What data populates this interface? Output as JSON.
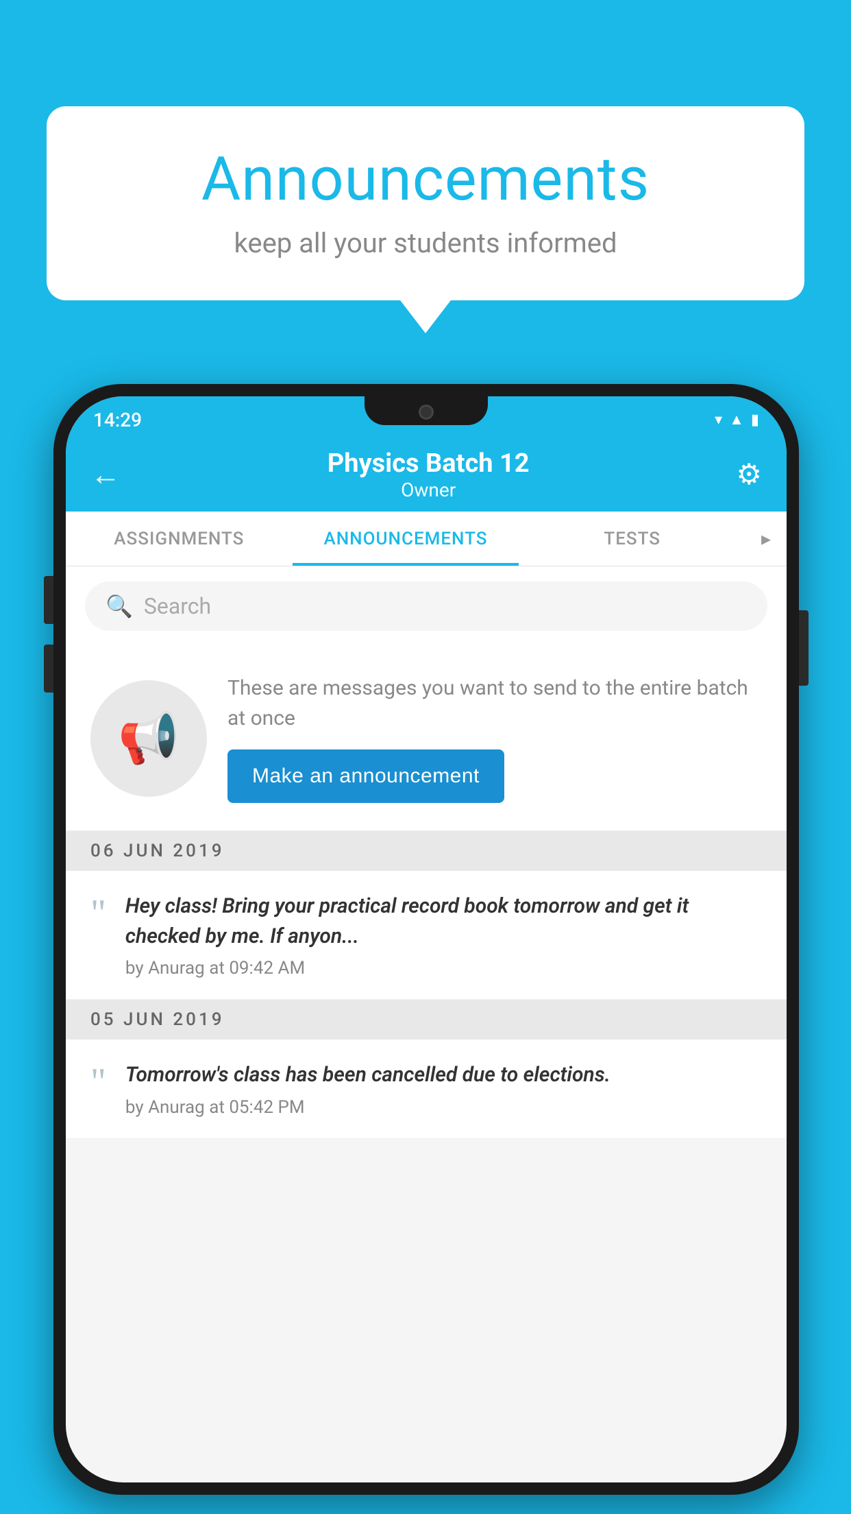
{
  "background_color": "#1ab9e8",
  "speech_bubble": {
    "title": "Announcements",
    "subtitle": "keep all your students informed"
  },
  "phone": {
    "status_bar": {
      "time": "14:29",
      "icons": [
        "wifi",
        "signal",
        "battery"
      ]
    },
    "app_bar": {
      "title": "Physics Batch 12",
      "subtitle": "Owner",
      "back_label": "←",
      "settings_label": "⚙"
    },
    "tabs": [
      {
        "label": "ASSIGNMENTS",
        "active": false
      },
      {
        "label": "ANNOUNCEMENTS",
        "active": true
      },
      {
        "label": "TESTS",
        "active": false
      }
    ],
    "search": {
      "placeholder": "Search"
    },
    "promo_section": {
      "description": "These are messages you want to send to the entire batch at once",
      "button_label": "Make an announcement"
    },
    "announcements": [
      {
        "date_separator": "06  JUN  2019",
        "text": "Hey class! Bring your practical record book tomorrow and get it checked by me. If anyon...",
        "meta": "by Anurag at 09:42 AM"
      },
      {
        "date_separator": "05  JUN  2019",
        "text": "Tomorrow's class has been cancelled due to elections.",
        "meta": "by Anurag at 05:42 PM"
      }
    ]
  }
}
